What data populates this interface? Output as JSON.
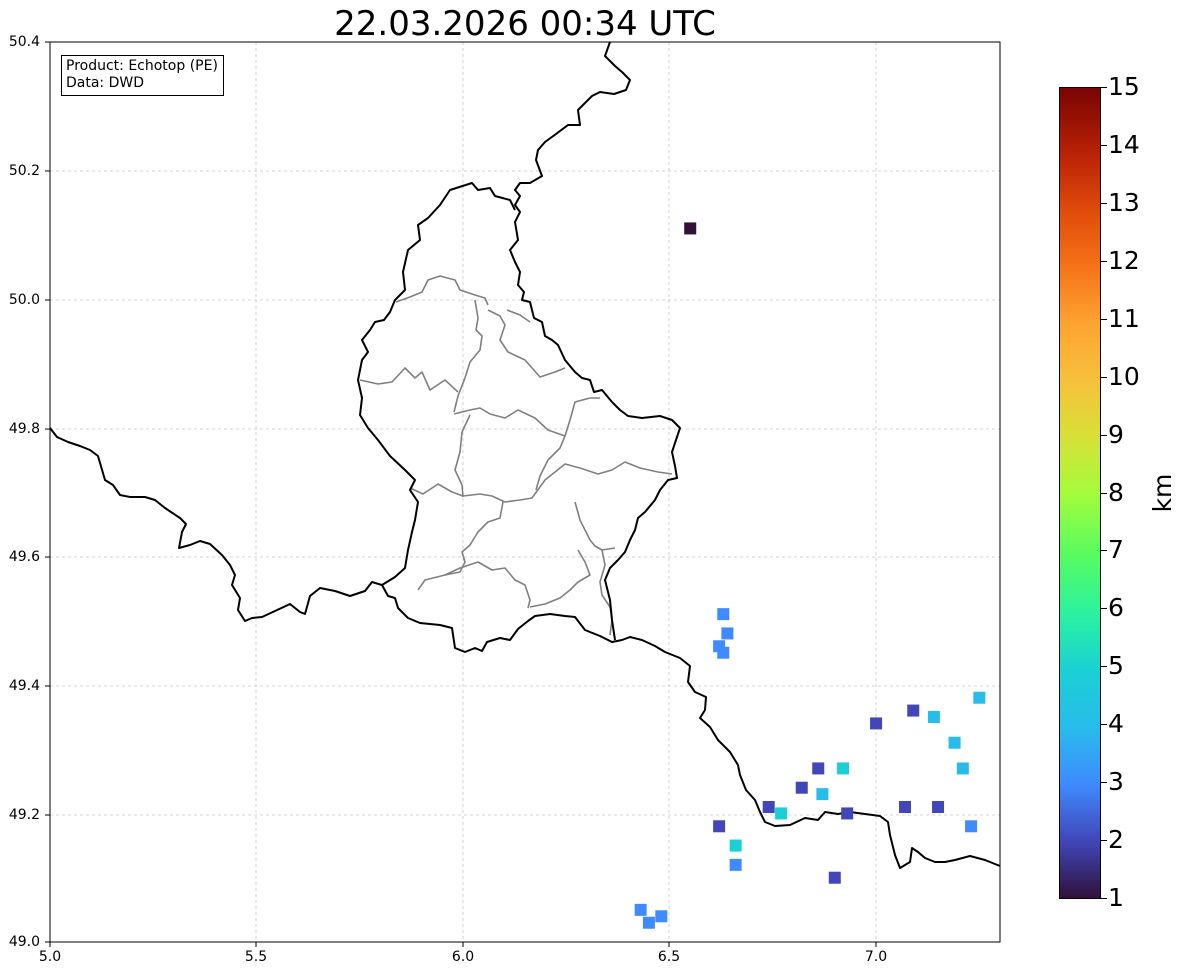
{
  "title": "22.03.2026 00:34 UTC",
  "info": {
    "product": "Product: Echotop (PE)",
    "source": "Data: DWD"
  },
  "axes": {
    "lon_range": [
      5.0,
      7.3
    ],
    "lat_range": [
      49.0,
      50.4
    ],
    "x_ticks": [
      "5.0",
      "5.5",
      "6.0",
      "6.5",
      "7.0"
    ],
    "y_ticks": [
      "50.4",
      "50.2",
      "50.0",
      "49.8",
      "49.6",
      "49.4",
      "49.2",
      "49.0"
    ],
    "grid": true
  },
  "colorbar": {
    "unit": "km",
    "min": 1,
    "max": 15,
    "labels": [
      "15",
      "14",
      "13",
      "12",
      "11",
      "10",
      "9",
      "8",
      "7",
      "6",
      "5",
      "4",
      "3",
      "2",
      "1"
    ],
    "colormap": "turbo"
  },
  "colors": {
    "border": "#000000",
    "district": "#808080",
    "grid": "#c8c8c8",
    "echo_1_5": "#30123b",
    "echo_2_5": "#4146b8",
    "echo_3_5": "#3e8afe",
    "echo_4_5": "#28bceb",
    "echo_5": "#1ad0d4"
  },
  "echo_cells": [
    {
      "lon": 6.55,
      "lat": 50.11,
      "km": 1.5
    },
    {
      "lon": 6.63,
      "lat": 49.51,
      "km": 3.5
    },
    {
      "lon": 6.64,
      "lat": 49.48,
      "km": 3.5
    },
    {
      "lon": 6.62,
      "lat": 49.46,
      "km": 3.5
    },
    {
      "lon": 6.63,
      "lat": 49.45,
      "km": 3.5
    },
    {
      "lon": 6.45,
      "lat": 49.03,
      "km": 3.5
    },
    {
      "lon": 6.43,
      "lat": 49.05,
      "km": 3.5
    },
    {
      "lon": 6.48,
      "lat": 49.04,
      "km": 3.5
    },
    {
      "lon": 6.62,
      "lat": 49.18,
      "km": 2.5
    },
    {
      "lon": 6.66,
      "lat": 49.15,
      "km": 5.0
    },
    {
      "lon": 6.66,
      "lat": 49.12,
      "km": 3.5
    },
    {
      "lon": 6.74,
      "lat": 49.21,
      "km": 2.5
    },
    {
      "lon": 6.77,
      "lat": 49.2,
      "km": 5.0
    },
    {
      "lon": 6.82,
      "lat": 49.24,
      "km": 2.5
    },
    {
      "lon": 6.86,
      "lat": 49.27,
      "km": 2.5
    },
    {
      "lon": 6.92,
      "lat": 49.27,
      "km": 5.0
    },
    {
      "lon": 6.87,
      "lat": 49.23,
      "km": 4.5
    },
    {
      "lon": 7.0,
      "lat": 49.34,
      "km": 2.5
    },
    {
      "lon": 7.09,
      "lat": 49.36,
      "km": 2.5
    },
    {
      "lon": 7.14,
      "lat": 49.35,
      "km": 4.5
    },
    {
      "lon": 7.25,
      "lat": 49.38,
      "km": 4.5
    },
    {
      "lon": 7.21,
      "lat": 49.27,
      "km": 4.5
    },
    {
      "lon": 7.15,
      "lat": 49.21,
      "km": 2.5
    },
    {
      "lon": 7.19,
      "lat": 49.31,
      "km": 4.5
    },
    {
      "lon": 7.23,
      "lat": 49.18,
      "km": 3.5
    },
    {
      "lon": 6.93,
      "lat": 49.2,
      "km": 2.5
    },
    {
      "lon": 6.9,
      "lat": 49.1,
      "km": 2.5
    },
    {
      "lon": 7.07,
      "lat": 49.21,
      "km": 2.5
    }
  ]
}
